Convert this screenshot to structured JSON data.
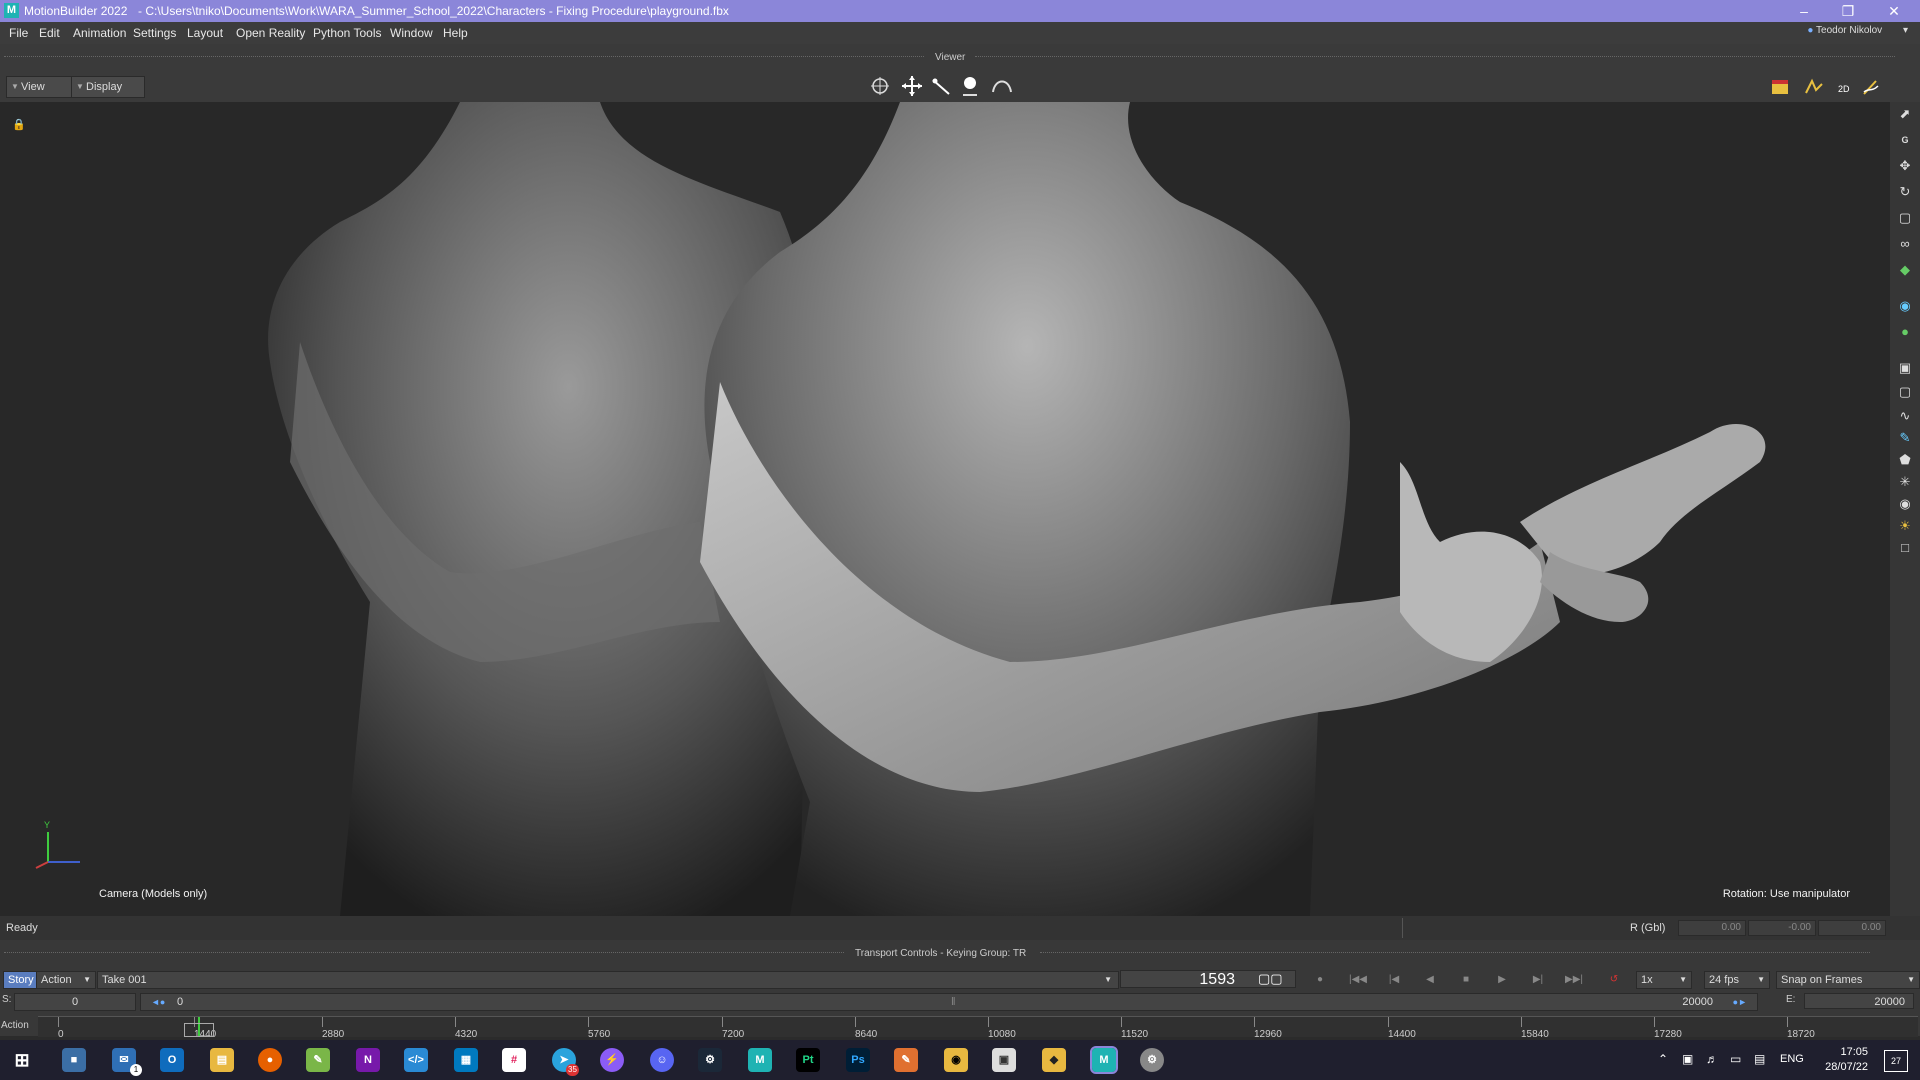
{
  "window": {
    "app_name": "MotionBuilder 2022",
    "file_path": "- C:\\Users\\tniko\\Documents\\Work\\WARA_Summer_School_2022\\Characters - Fixing Procedure\\playground.fbx",
    "logo_letter": "M",
    "minimize": "–",
    "restore": "❐",
    "close": "✕"
  },
  "menu": {
    "items": [
      "File",
      "Edit",
      "Animation",
      "Settings",
      "Layout",
      "Open Reality",
      "Python Tools",
      "Window",
      "Help"
    ],
    "user": "Teodor Nikolov"
  },
  "viewer": {
    "label": "Viewer",
    "view_button": "View",
    "display_button": "Display",
    "camera_label": "Camera (Models only)",
    "rotation_label": "Rotation: Use manipulator",
    "axis_y": "Y"
  },
  "status": {
    "text": "Ready",
    "coord_label": "R (Gbl)",
    "x": "0.00",
    "y": "-0.00",
    "z": "0.00"
  },
  "transport": {
    "title": "Transport Controls  -  Keying Group: TR",
    "story_tab": "Story",
    "action_select": "Action",
    "take": "Take 001",
    "current_frame": "1593",
    "speed": "1x",
    "fps": "24 fps",
    "snap": "Snap on Frames",
    "start_label": "S:",
    "start_value": "0",
    "range_start": "0",
    "range_end": "20000",
    "end_label": "E:",
    "end_value": "20000",
    "track_label": "Action",
    "timeline_ticks": [
      "0",
      "1440",
      "2880",
      "4320",
      "5760",
      "7200",
      "8640",
      "10080",
      "11520",
      "12960",
      "14400",
      "15840",
      "17280",
      "18720"
    ]
  },
  "taskbar": {
    "apps": [
      "Start",
      "Files",
      "Mail",
      "Outlook",
      "Explorer",
      "Firefox",
      "Notepad",
      "OneNote",
      "VS Code",
      "Trello",
      "Slack",
      "Telegram",
      "Messenger",
      "Discord",
      "Steam",
      "MotionBuilder",
      "PyCharm",
      "Photoshop",
      "Krita",
      "Blender",
      "Remote",
      "Git",
      "MotionBuilder",
      "Settings"
    ],
    "mail_badge": "1",
    "telegram_badge": "35",
    "lang": "ENG",
    "time": "17:05",
    "date": "28/07/22",
    "notif_count": "27"
  },
  "colors": {
    "titlebar": "#8b86d9",
    "viewport": "#282828",
    "accent": "#1fb3b3"
  }
}
